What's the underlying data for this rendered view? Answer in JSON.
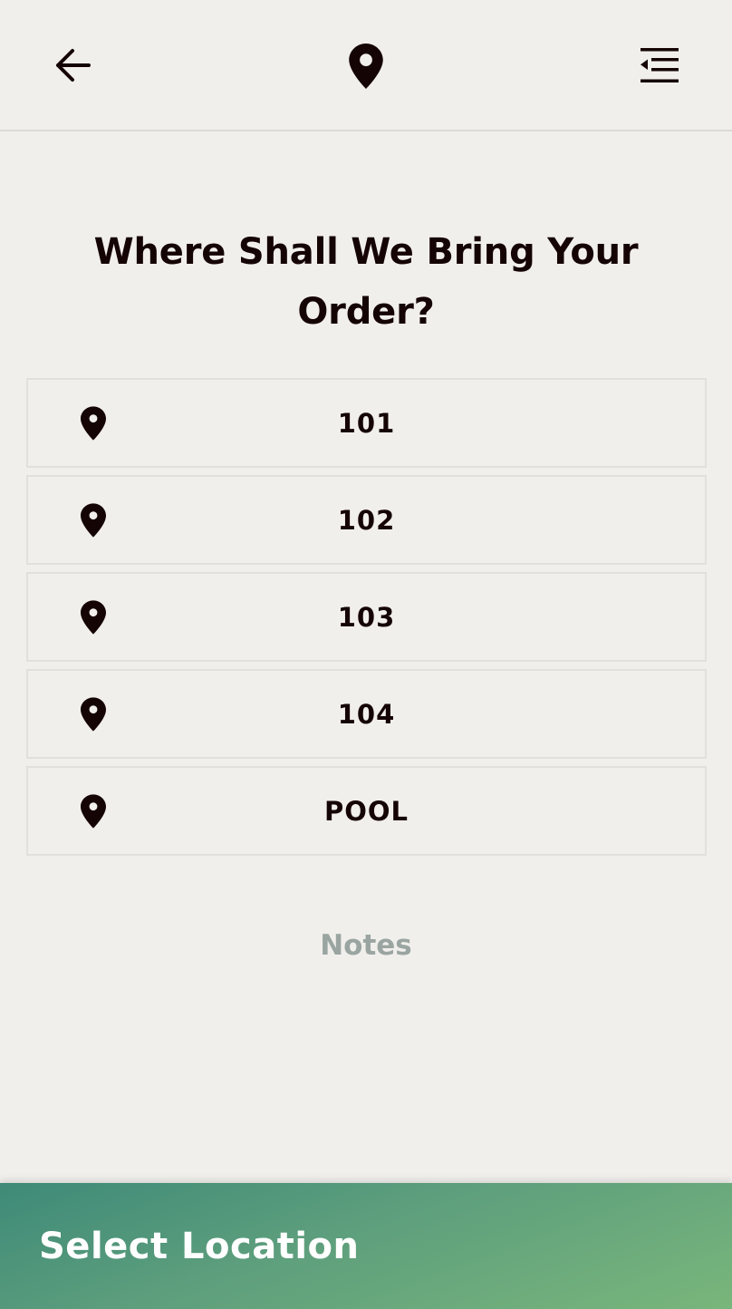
{
  "header": {
    "back_icon": "arrow-left-icon",
    "logo_icon": "map-pin-icon",
    "menu_icon": "menu-collapse-icon"
  },
  "title": "Where Shall We Bring Your Order?",
  "locations": [
    {
      "label": "101",
      "icon": "map-pin-icon"
    },
    {
      "label": "102",
      "icon": "map-pin-icon"
    },
    {
      "label": "103",
      "icon": "map-pin-icon"
    },
    {
      "label": "104",
      "icon": "map-pin-icon"
    },
    {
      "label": "POOL",
      "icon": "map-pin-icon"
    }
  ],
  "notes_label": "Notes",
  "cta_label": "Select Location",
  "colors": {
    "background": "#f1efec",
    "text": "#150404",
    "notes_text": "#9aa5a2",
    "cta_gradient_start": "#3e8a78",
    "cta_gradient_end": "#79b67b"
  }
}
